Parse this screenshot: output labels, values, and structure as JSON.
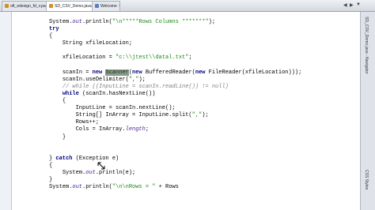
{
  "tabs": [
    {
      "label": "oft_edesign_fd_v.java"
    },
    {
      "label": "SD_CSV_Demo.java"
    },
    {
      "label": "Welcome"
    }
  ],
  "code": {
    "l1_stmt": "System.",
    "l1_out": "out",
    "l1_call": ".println(",
    "l1_str": "\"\\n*****Rows Columns *******\"",
    "l1_end": ");",
    "l2_kw": "try",
    "l3": "{",
    "l4": "String xfileLocation;",
    "l5_a": "xfileLocation = ",
    "l5_str": "\"c:\\\\jtest\\\\datal.txt\"",
    "l5_end": ";",
    "l6_a": "scanIn = ",
    "l6_new": "new",
    "l6_hl": "Scanner",
    "l6_b": "(",
    "l6_new2": "new",
    "l6_c": " BufferedReader(",
    "l6_new3": "new",
    "l6_d": " FileReader(xfileLocation)));",
    "l7_a": "scanIn.useDelimiter(",
    "l7_str": "\",\"",
    "l7_end": ");",
    "l8_cm": "// while ((InputLine = scanIn.readLine()) != null)",
    "l9_kw": "while",
    "l9_a": " (scanIn.hasNextLine())",
    "l10": "{",
    "l11": "InputLine = scanIn.nextLine();",
    "l12_a": "String[] InArray = InputLine.split(",
    "l12_str": "\",\"",
    "l12_end": ");",
    "l13": "Rows++;",
    "l14_a": "Cols = InArray.",
    "l14_fld": "length",
    "l14_end": ";",
    "l15": "}",
    "l16": "}",
    "l16_kw": "catch",
    "l16_a": " (Exception e)",
    "l17": "{",
    "l18_a": "System.",
    "l18_out": "out",
    "l18_b": ".println(e);",
    "l19": "}",
    "l20_a": "System.",
    "l20_out": "out",
    "l20_b": ".println(",
    "l20_str": "\"\\n\\nRows = \"",
    "l20_c": " + Rows"
  },
  "side_panel": {
    "tabs": [
      "SD_CSV_Demo.java - Navigator",
      "CSS Styles"
    ]
  }
}
